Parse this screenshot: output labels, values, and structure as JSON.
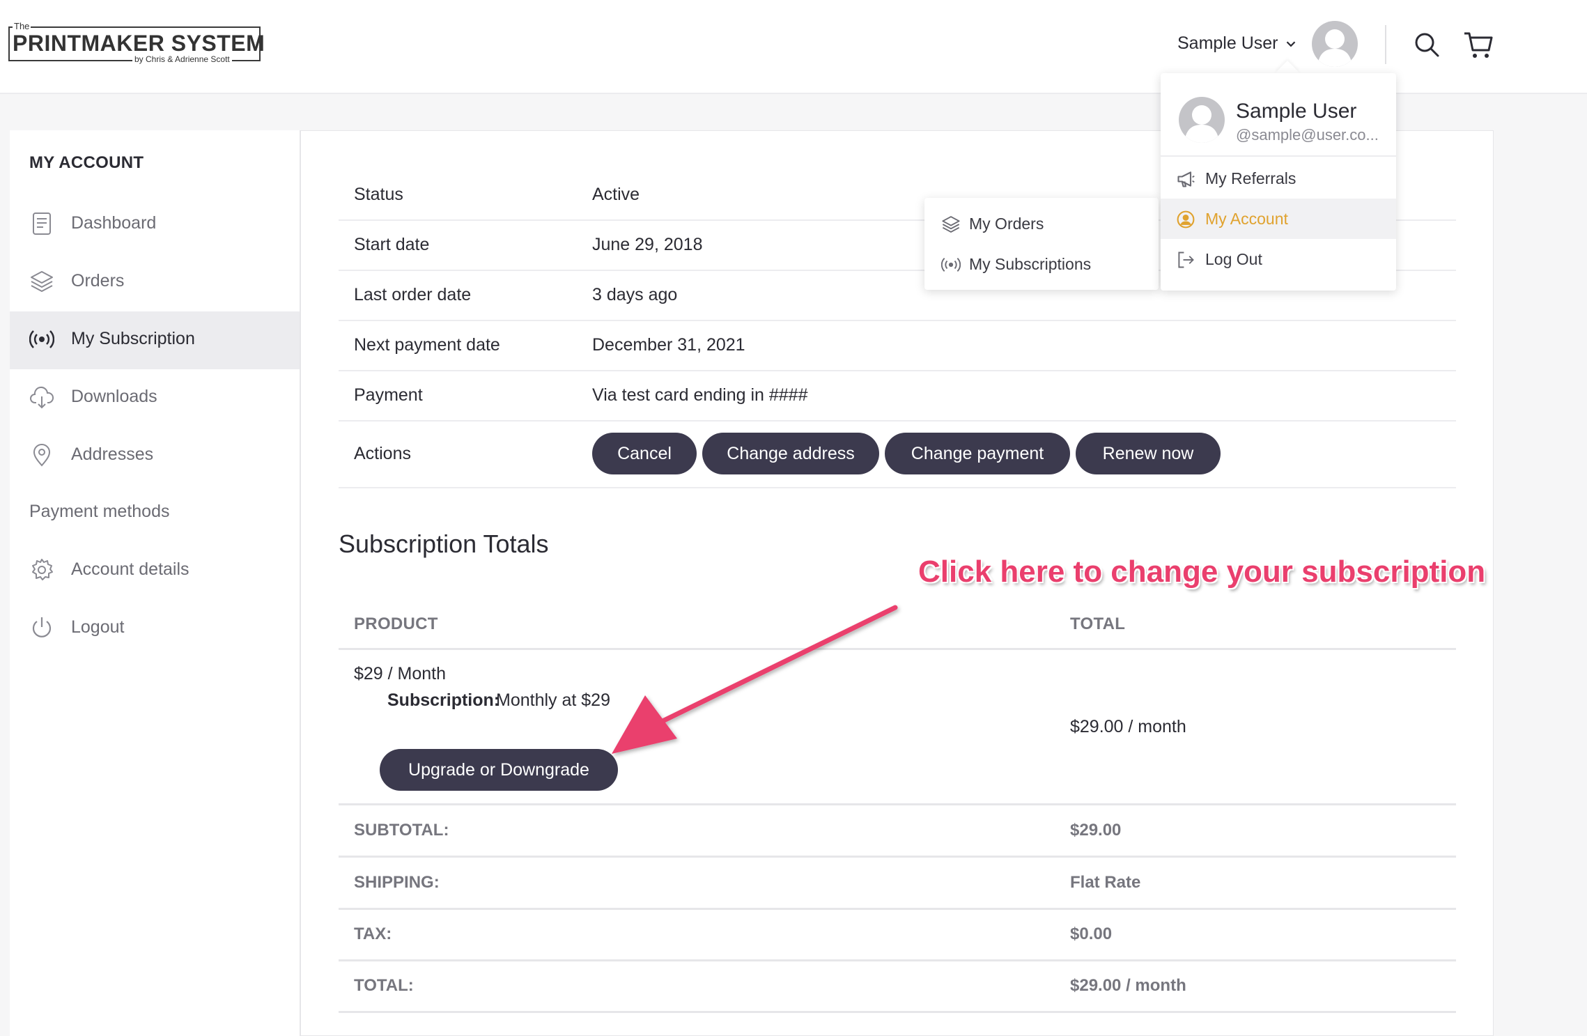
{
  "brand": {
    "logo_the": "The",
    "logo_main": "PRINTMAKER SYSTEM",
    "logo_sub": "by Chris & Adrienne Scott"
  },
  "header": {
    "user_name": "Sample User"
  },
  "user_menu": {
    "name": "Sample User",
    "email": "@sample@user.co...",
    "items": [
      {
        "label": "My Referrals",
        "icon": "megaphone-icon"
      },
      {
        "label": "My Account",
        "icon": "user-circle-icon",
        "active": true
      },
      {
        "label": "Log Out",
        "icon": "logout-icon"
      }
    ]
  },
  "account_submenu": {
    "items": [
      {
        "label": "My Orders",
        "icon": "layers-icon"
      },
      {
        "label": "My Subscriptions",
        "icon": "broadcast-icon"
      }
    ]
  },
  "sidebar": {
    "title": "MY ACCOUNT",
    "items": [
      {
        "label": "Dashboard",
        "icon": "dashboard-icon"
      },
      {
        "label": "Orders",
        "icon": "layers-icon"
      },
      {
        "label": "My Subscription",
        "icon": "broadcast-icon",
        "active": true
      },
      {
        "label": "Downloads",
        "icon": "cloud-download-icon"
      },
      {
        "label": "Addresses",
        "icon": "location-pin-icon"
      },
      {
        "label": "Payment methods",
        "icon": ""
      },
      {
        "label": "Account details",
        "icon": "gear-icon"
      },
      {
        "label": "Logout",
        "icon": "power-icon"
      }
    ]
  },
  "subscription": {
    "rows": [
      {
        "key": "Status",
        "value": "Active"
      },
      {
        "key": "Start date",
        "value": "June 29, 2018"
      },
      {
        "key": "Last order date",
        "value": "3 days ago"
      },
      {
        "key": "Next payment date",
        "value": "December 31, 2021"
      },
      {
        "key": "Payment",
        "value": "Via test card ending in ####"
      }
    ],
    "actions_label": "Actions",
    "actions": [
      "Cancel",
      "Change address",
      "Change payment",
      "Renew now"
    ]
  },
  "totals": {
    "title": "Subscription Totals",
    "annotation": "Click here to change your subscription",
    "col_product": "PRODUCT",
    "col_total": "TOTAL",
    "product_name": "$29 / Month",
    "product_meta_label": "Subscription:",
    "product_meta_value": "Monthly at $29",
    "product_total": "$29.00 / month",
    "upgrade_button": "Upgrade or Downgrade",
    "summary": [
      {
        "label": "SUBTOTAL:",
        "value": "$29.00"
      },
      {
        "label": "SHIPPING:",
        "value": "Flat Rate"
      },
      {
        "label": "TAX:",
        "value": "$0.00"
      },
      {
        "label": "TOTAL:",
        "value": "$29.00 / month"
      }
    ]
  },
  "colors": {
    "accent_button": "#3c3a4e",
    "annotation": "#ea3f6d",
    "active_menu": "#e0a22e"
  }
}
